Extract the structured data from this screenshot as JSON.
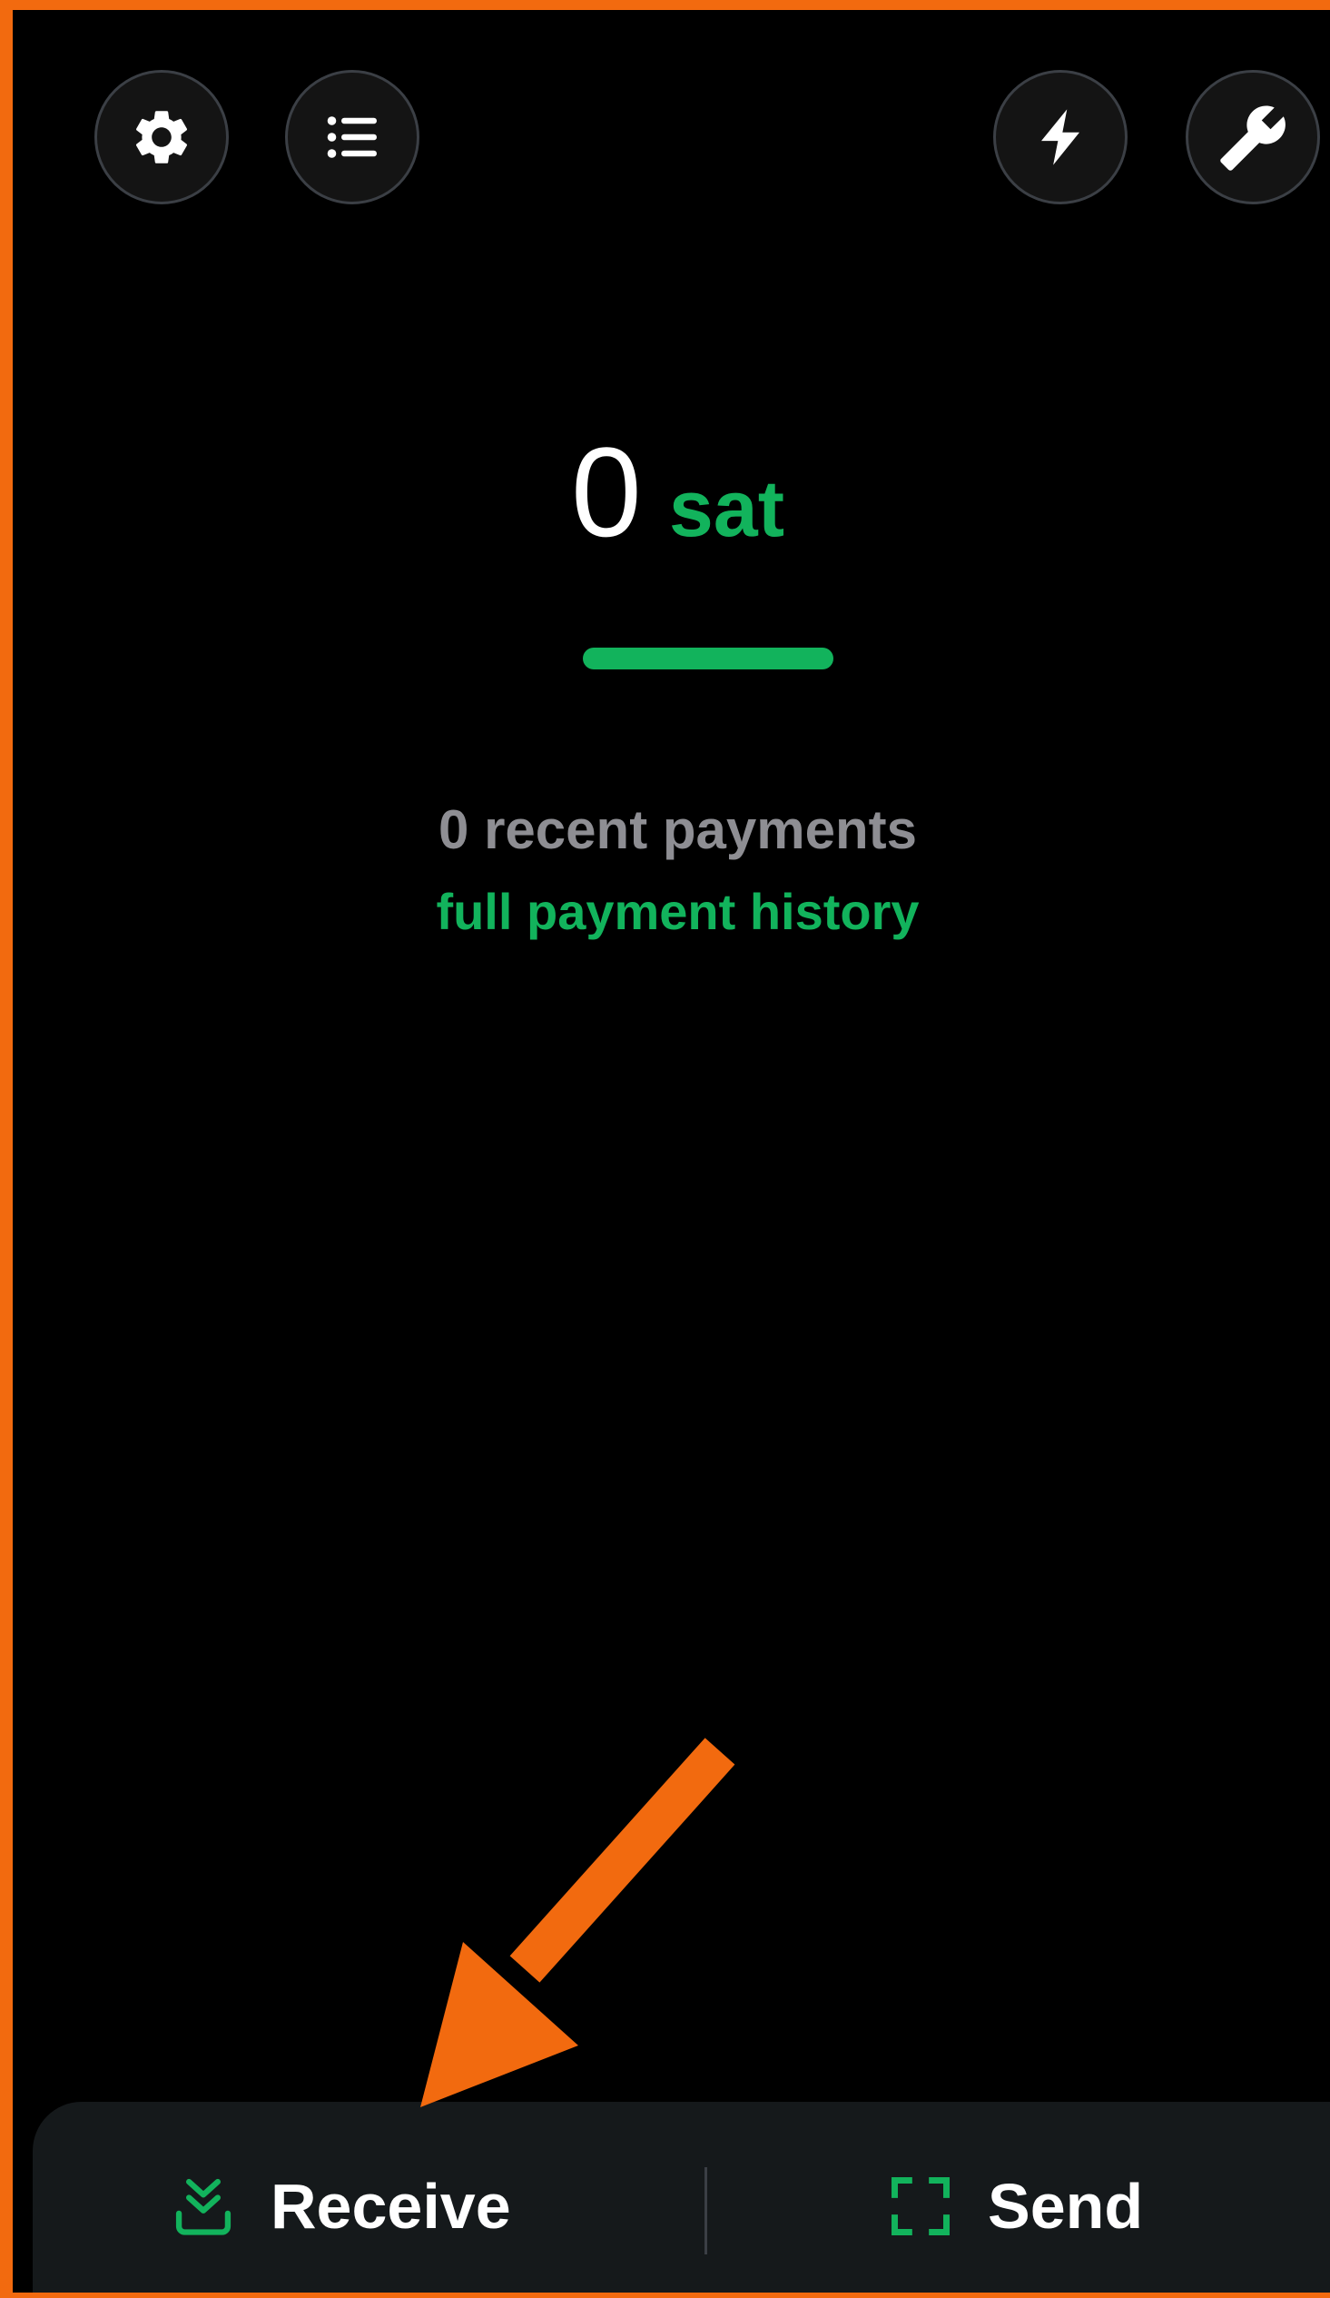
{
  "header": {
    "left_buttons": [
      {
        "name": "settings",
        "icon": "gear-icon"
      },
      {
        "name": "menu",
        "icon": "list-icon"
      }
    ],
    "right_buttons": [
      {
        "name": "lightning",
        "icon": "lightning-icon"
      },
      {
        "name": "tools",
        "icon": "wrench-icon"
      }
    ]
  },
  "balance": {
    "amount": "0",
    "unit": "sat"
  },
  "payments": {
    "recent_count_text": "0 recent payments",
    "history_link": "full payment history"
  },
  "bottom_bar": {
    "receive_label": "Receive",
    "receive_icon": "receive-download-icon",
    "send_label": "Send",
    "send_icon": "scan-frame-icon"
  },
  "colors": {
    "background": "#000000",
    "accent_green": "#12b35c",
    "annotation_orange": "#f26a0f",
    "muted_text": "#8e8e93",
    "bottom_bar": "#15191b"
  }
}
